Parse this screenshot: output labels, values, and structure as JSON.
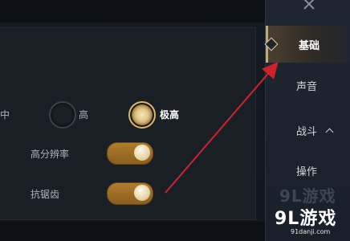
{
  "settings": {
    "quality_partial_label": "中",
    "quality_high_label": "高",
    "quality_ultra_label": "极高",
    "quality_selected": "极高",
    "hires_label": "高分辨率",
    "hires_enabled": true,
    "antialias_label": "抗锯齿",
    "antialias_enabled": true
  },
  "sidebar": {
    "items": [
      {
        "label": "基础",
        "active": true
      },
      {
        "label": "声音",
        "active": false
      },
      {
        "label": "战斗",
        "active": false,
        "expanded": true
      },
      {
        "label": "操作",
        "active": false
      }
    ]
  },
  "watermark": {
    "faint": "9L游戏",
    "logo": "9L游戏",
    "url": "91danji.com"
  },
  "colors": {
    "accent_gold": "#c9a864",
    "toggle_on": "#a0722a",
    "annotation_arrow": "#d0222c"
  },
  "icons": {
    "close": "close-icon",
    "chevron": "chevron-up-icon",
    "active_marker": "diamond-icon"
  }
}
